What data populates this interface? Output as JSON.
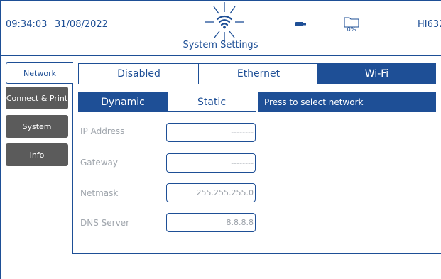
{
  "status_bar": {
    "time": "09:34:03",
    "date": "31/08/2022",
    "storage_percent": "0%",
    "model": "HI632"
  },
  "page_title": "System Settings",
  "sidebar": {
    "items": [
      {
        "label": "Network",
        "active": true
      },
      {
        "label": "Connect & Print",
        "active": false
      },
      {
        "label": "System",
        "active": false
      },
      {
        "label": "Info",
        "active": false
      }
    ]
  },
  "network": {
    "modes": [
      "Disabled",
      "Ethernet",
      "Wi-Fi"
    ],
    "selected_mode": "Wi-Fi",
    "ip_modes": [
      "Dynamic",
      "Static"
    ],
    "selected_ip_mode": "Dynamic",
    "network_select_label": "Press to select network",
    "fields": [
      {
        "label": "IP Address",
        "value": "--------"
      },
      {
        "label": "Gateway",
        "value": "--------"
      },
      {
        "label": "Netmask",
        "value": "255.255.255.0"
      },
      {
        "label": "DNS Server",
        "value": "8.8.8.8"
      }
    ]
  },
  "colors": {
    "accent": "#1e4f96",
    "inactive_nav": "#5b5b5b",
    "muted_text": "#a0a6ad"
  }
}
